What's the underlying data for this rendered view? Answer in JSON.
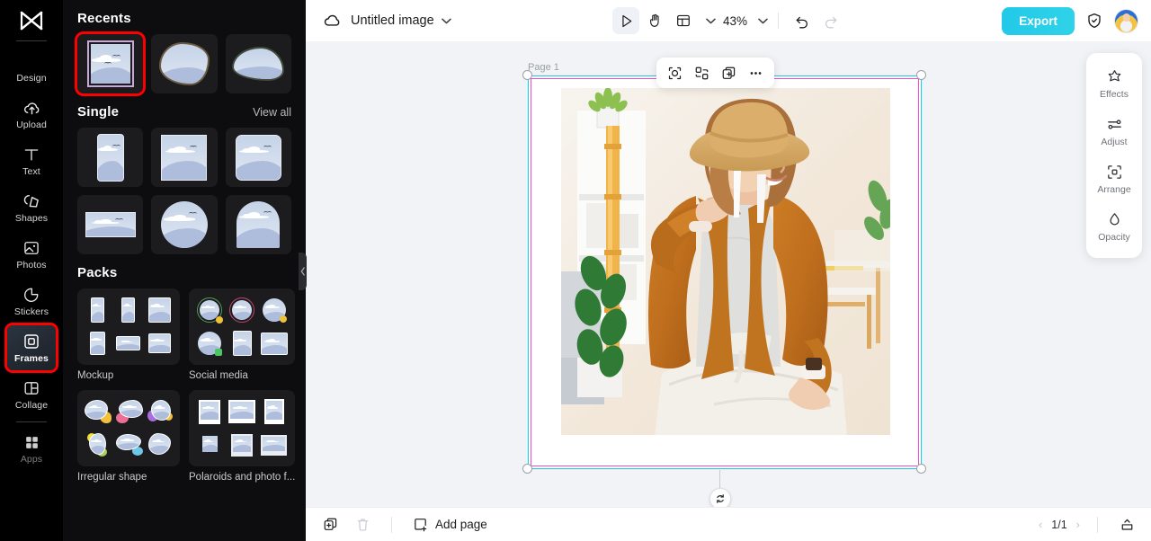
{
  "rail": {
    "logo": "capcut-logo",
    "items": [
      {
        "label": "Design",
        "icon": "design-icon",
        "state": "normal"
      },
      {
        "label": "Upload",
        "icon": "upload-cloud-icon",
        "state": "normal"
      },
      {
        "label": "Text",
        "icon": "text-icon",
        "state": "normal"
      },
      {
        "label": "Shapes",
        "icon": "shapes-icon",
        "state": "normal"
      },
      {
        "label": "Photos",
        "icon": "photos-icon",
        "state": "normal"
      },
      {
        "label": "Stickers",
        "icon": "stickers-icon",
        "state": "normal"
      },
      {
        "label": "Frames",
        "icon": "frames-icon",
        "state": "active-highlighted"
      },
      {
        "label": "Collage",
        "icon": "collage-icon",
        "state": "normal"
      },
      {
        "label": "Apps",
        "icon": "apps-icon",
        "state": "dim"
      }
    ]
  },
  "panel": {
    "recents": {
      "title": "Recents",
      "items": [
        {
          "name": "square-frame",
          "shape": "square",
          "selected": true
        },
        {
          "name": "blob-frame-1",
          "shape": "blob1",
          "selected": false
        },
        {
          "name": "blob-frame-2",
          "shape": "blob2",
          "selected": false
        }
      ]
    },
    "single": {
      "title": "Single",
      "view_all": "View all",
      "items": [
        {
          "name": "portrait-rounded-frame",
          "shape": "portrait"
        },
        {
          "name": "square-frame",
          "shape": "square"
        },
        {
          "name": "rounded-square-frame",
          "shape": "rsquare"
        },
        {
          "name": "landscape-frame",
          "shape": "landscape"
        },
        {
          "name": "circle-frame",
          "shape": "circle"
        },
        {
          "name": "arch-frame",
          "shape": "arch"
        }
      ],
      "next_arrow": "chevron-right-icon"
    },
    "packs": {
      "title": "Packs",
      "items": [
        {
          "label": "Mockup",
          "name": "pack-mockup"
        },
        {
          "label": "Social media",
          "name": "pack-social-media"
        },
        {
          "label": "Irregular shape",
          "name": "pack-irregular-shape"
        },
        {
          "label": "Polaroids and photo f...",
          "name": "pack-polaroids"
        }
      ]
    },
    "collapse": "chevron-left-icon"
  },
  "topbar": {
    "cloud_icon": "cloud-save-icon",
    "doc_title": "Untitled image",
    "title_chevron": "chevron-down-icon",
    "tools": [
      {
        "name": "select-tool",
        "icon": "cursor-arrow-icon",
        "active": true
      },
      {
        "name": "hand-tool",
        "icon": "hand-icon",
        "active": false
      },
      {
        "name": "layout-tool",
        "icon": "layout-panel-icon",
        "active": false
      }
    ],
    "zoom": "43%",
    "zoom_chevron": "chevron-down-icon",
    "undo": "undo-icon",
    "redo": "redo-icon",
    "export_label": "Export",
    "shield_icon": "shield-check-icon",
    "avatar": "user-avatar"
  },
  "canvas": {
    "page_label": "Page 1",
    "selection": {
      "outer_color": "#17d2e6",
      "inner_color": "#f348d6",
      "handles": 4,
      "rotate_handle": "rotate-icon"
    },
    "float_toolbar": [
      {
        "name": "auto-cutout-button",
        "icon": "cutout-icon"
      },
      {
        "name": "replace-image-button",
        "icon": "replace-icon"
      },
      {
        "name": "duplicate-button",
        "icon": "duplicate-plus-icon"
      },
      {
        "name": "more-options-button",
        "icon": "ellipsis-icon"
      }
    ],
    "photo_alt": "woman-in-straw-hat-and-mustard-cardigan-sitting-indoors"
  },
  "right_panel": {
    "items": [
      {
        "label": "Effects",
        "icon": "sparkle-star-icon"
      },
      {
        "label": "Adjust",
        "icon": "sliders-icon"
      },
      {
        "label": "Arrange",
        "icon": "arrange-icon"
      },
      {
        "label": "Opacity",
        "icon": "droplet-icon"
      }
    ]
  },
  "bottombar": {
    "duplicate_page": "duplicate-page-icon",
    "delete_page": "trash-icon",
    "add_page_label": "Add page",
    "add_page_icon": "add-page-icon",
    "prev": "‹",
    "page_indicator": "1/1",
    "next": "›",
    "present_icon": "present-icon"
  },
  "colors": {
    "accent": "#22c9e8",
    "highlight": "#ff0000",
    "selection_cyan": "#17d2e6",
    "selection_magenta": "#f348d6",
    "rail_bg": "#000000",
    "panel_bg": "#0d0d0f"
  }
}
